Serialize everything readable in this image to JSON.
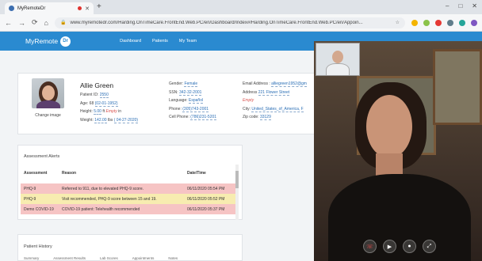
{
  "browser": {
    "tab_title": "MyRemoteDr",
    "url": "www.myremotedr.com/Harding.OnTimeCare.FrontEnd.Web.PC/en/Dashboard/Index#/Harding.OnTimeCare.FrontEnd.Web.PC/en/Appoin..."
  },
  "app": {
    "logo_text": "MyRemote",
    "logo_badge": "Dr",
    "nav": [
      "Dashboard",
      "Patients",
      "My Team"
    ]
  },
  "patient": {
    "name": "Allie  Green",
    "change_image": "Change image",
    "id_label": "Patient ID:",
    "id": "2550",
    "age_label": "Age: 68",
    "dob": "(02-01-1952)",
    "height_label": "Height:",
    "height": "5.00",
    "height_unit": "ft",
    "height_empty": "Empty",
    "height_unit2": "in",
    "weight_label": "Weight:",
    "weight": "142.00",
    "weight_unit": "lbs",
    "weight_date": "( 04-27-2020)",
    "gender_label": "Gender:",
    "gender": "Female",
    "ssn_label": "SSN:",
    "ssn": "342-32-2001",
    "language_label": "Language:",
    "language": "Español",
    "phone_label": "Phone:",
    "phone": "(305)743-2001",
    "cell_label": "Cell Phone:",
    "cell": "(786)231-5201",
    "email_label": "Email Address :",
    "email": "alliegreen1952@gm",
    "address_label": "Address",
    "address": "221 Flower Street",
    "address2_empty": "Empty",
    "city_label": "City:",
    "city": "United_States_of_America, F",
    "zip_label": "Zip code:",
    "zip": "33129"
  },
  "alerts": {
    "title": "Assessment Alerts",
    "columns": [
      "Assessment",
      "Reason",
      "Date/Time"
    ],
    "rows": [
      {
        "assessment": "PHQ-9",
        "reason": "Referred to 911, due to elevated PHQ-9 score.",
        "datetime": "06/11/2020 05:54 PM"
      },
      {
        "assessment": "PHQ-9",
        "reason": "Visit recommended, PHQ-9 score between 15 and 19.",
        "datetime": "06/11/2020 05:52 PM"
      },
      {
        "assessment": "Demo COVID-19",
        "reason": "COVID-19 patient: Telehealth recommended",
        "datetime": "06/11/2020 05:37 PM"
      }
    ],
    "colors": {
      "red": "#f6c4c4",
      "yellow": "#f7ecb0"
    }
  },
  "history": {
    "title": "Patient History",
    "tabs": [
      "Summary",
      "Assessment Results",
      "Lab Scores",
      "Appointments",
      "Notes"
    ]
  },
  "video": {
    "controls": [
      "end-call-icon",
      "camera-icon",
      "microphone-icon",
      "expand-icon"
    ]
  },
  "theme": {
    "primary": "#2a8ad0"
  }
}
